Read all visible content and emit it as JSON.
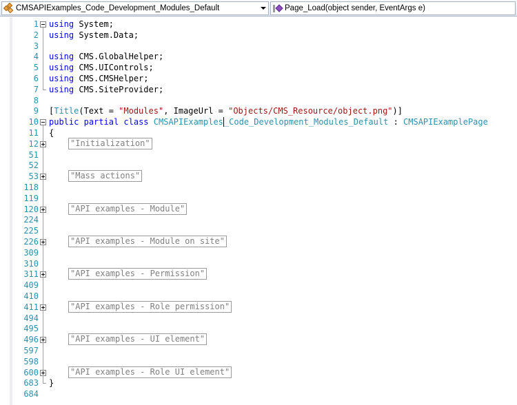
{
  "navbar": {
    "class_combo": "CMSAPIExamples_Code_Development_Modules_Default",
    "member_combo": "Page_Load(object sender, EventArgs e)"
  },
  "lines": [
    {
      "n": "1",
      "tokens": [
        [
          "kw",
          "using"
        ],
        [
          "tx",
          " System;"
        ]
      ]
    },
    {
      "n": "2",
      "tokens": [
        [
          "kw",
          "using"
        ],
        [
          "tx",
          " System.Data;"
        ]
      ]
    },
    {
      "n": "3",
      "tokens": []
    },
    {
      "n": "4",
      "tokens": [
        [
          "kw",
          "using"
        ],
        [
          "tx",
          " CMS.GlobalHelper;"
        ]
      ]
    },
    {
      "n": "5",
      "tokens": [
        [
          "kw",
          "using"
        ],
        [
          "tx",
          " CMS.UIControls;"
        ]
      ]
    },
    {
      "n": "6",
      "tokens": [
        [
          "kw",
          "using"
        ],
        [
          "tx",
          " CMS.CMSHelper;"
        ]
      ]
    },
    {
      "n": "7",
      "tokens": [
        [
          "kw",
          "using"
        ],
        [
          "tx",
          " CMS.SiteProvider;"
        ]
      ]
    },
    {
      "n": "8",
      "tokens": []
    },
    {
      "n": "9",
      "tokens": [
        [
          "tx",
          "["
        ],
        [
          "tp",
          "Title"
        ],
        [
          "tx",
          "(Text = "
        ],
        [
          "str",
          "\"Modules\""
        ],
        [
          "tx",
          ", ImageUrl = "
        ],
        [
          "str",
          "\"Objects/CMS_Resource/object.png\""
        ],
        [
          "tx",
          ")]"
        ]
      ]
    },
    {
      "n": "10",
      "tokens": [
        [
          "kw",
          "public"
        ],
        [
          "tx",
          " "
        ],
        [
          "kw",
          "partial"
        ],
        [
          "tx",
          " "
        ],
        [
          "kw",
          "class"
        ],
        [
          "tx",
          " "
        ],
        [
          "tp",
          "CMSAPIExamples"
        ],
        [
          "caret",
          ""
        ],
        [
          "tp",
          "_Code_Development_Modules_Default"
        ],
        [
          "tx",
          " : "
        ],
        [
          "tp",
          "CMSAPIExamplePage"
        ]
      ]
    },
    {
      "n": "11",
      "tokens": [
        [
          "tx",
          "{"
        ]
      ]
    },
    {
      "n": "12",
      "region": "\"Initialization\""
    },
    {
      "n": "51",
      "tokens": []
    },
    {
      "n": "52",
      "tokens": []
    },
    {
      "n": "53",
      "region": "\"Mass actions\""
    },
    {
      "n": "118",
      "tokens": []
    },
    {
      "n": "119",
      "tokens": []
    },
    {
      "n": "120",
      "region": "\"API examples - Module\""
    },
    {
      "n": "224",
      "tokens": []
    },
    {
      "n": "225",
      "tokens": []
    },
    {
      "n": "226",
      "region": "\"API examples - Module on site\""
    },
    {
      "n": "309",
      "tokens": []
    },
    {
      "n": "310",
      "tokens": []
    },
    {
      "n": "311",
      "region": "\"API examples - Permission\""
    },
    {
      "n": "409",
      "tokens": []
    },
    {
      "n": "410",
      "tokens": []
    },
    {
      "n": "411",
      "region": "\"API examples - Role permission\""
    },
    {
      "n": "494",
      "tokens": []
    },
    {
      "n": "495",
      "tokens": []
    },
    {
      "n": "496",
      "region": "\"API examples - UI element\""
    },
    {
      "n": "597",
      "tokens": []
    },
    {
      "n": "598",
      "tokens": []
    },
    {
      "n": "600",
      "region": "\"API examples - Role UI element\""
    },
    {
      "n": "683",
      "tokens": [
        [
          "tx",
          "}"
        ]
      ]
    },
    {
      "n": "684",
      "tokens": []
    }
  ]
}
